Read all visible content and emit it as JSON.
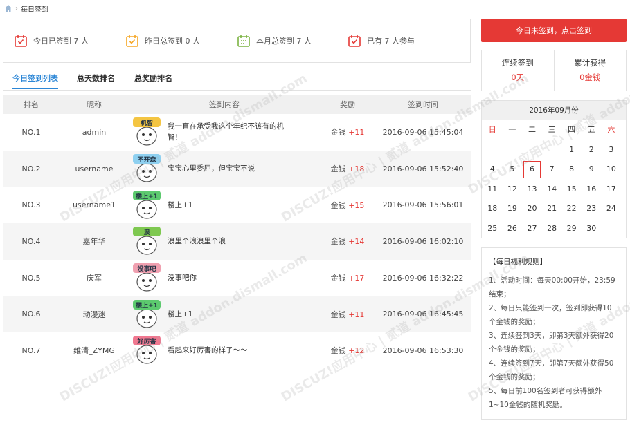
{
  "breadcrumb": {
    "current": "每日签到"
  },
  "stats": [
    {
      "text": "今日已签到 7 人",
      "color": "#e53935"
    },
    {
      "text": "昨日总签到 0 人",
      "color": "#f5a623"
    },
    {
      "text": "本月总签到 7 人",
      "color": "#7cb342"
    },
    {
      "text": "已有 7 人参与",
      "color": "#e53935"
    }
  ],
  "tabs": [
    {
      "label": "今日签到列表",
      "active": true
    },
    {
      "label": "总天数排名",
      "active": false
    },
    {
      "label": "总奖励排名",
      "active": false
    }
  ],
  "table": {
    "headers": [
      "排名",
      "昵称",
      "签到内容",
      "奖励",
      "签到时间"
    ],
    "rows": [
      {
        "rank": "NO.1",
        "name": "admin",
        "sticker_text": "机智",
        "message": "我一直在承受我这个年纪不该有的机智！",
        "reward_label": "金钱",
        "reward_value": "+11",
        "time": "2016-09-06 15:45:04"
      },
      {
        "rank": "NO.2",
        "name": "username",
        "sticker_text": "不开森",
        "message": "宝宝心里委屈，但宝宝不说",
        "reward_label": "金钱",
        "reward_value": "+18",
        "time": "2016-09-06 15:52:40"
      },
      {
        "rank": "NO.3",
        "name": "username1",
        "sticker_text": "楼上+1",
        "message": "楼上+1",
        "reward_label": "金钱",
        "reward_value": "+15",
        "time": "2016-09-06 15:56:01"
      },
      {
        "rank": "NO.4",
        "name": "嘉年华",
        "sticker_text": "浪",
        "message": "浪里个浪浪里个浪",
        "reward_label": "金钱",
        "reward_value": "+14",
        "time": "2016-09-06 16:02:10"
      },
      {
        "rank": "NO.5",
        "name": "庆军",
        "sticker_text": "没事吧",
        "message": "没事吧你",
        "reward_label": "金钱",
        "reward_value": "+17",
        "time": "2016-09-06 16:32:22"
      },
      {
        "rank": "NO.6",
        "name": "动漫迷",
        "sticker_text": "楼上+1",
        "message": "楼上+1",
        "reward_label": "金钱",
        "reward_value": "+11",
        "time": "2016-09-06 16:45:45"
      },
      {
        "rank": "NO.7",
        "name": "维清_ZYMG",
        "sticker_text": "好厉害",
        "message": "看起来好厉害的样子～～",
        "reward_label": "金钱",
        "reward_value": "+12",
        "time": "2016-09-06 16:53:30"
      }
    ]
  },
  "signin_button": "今日未签到，点击签到",
  "streak": {
    "continuous_label": "连续签到",
    "continuous_value": "0天",
    "total_label": "累计获得",
    "total_value": "0金钱"
  },
  "calendar": {
    "title": "2016年09月份",
    "weekdays": [
      "日",
      "一",
      "二",
      "三",
      "四",
      "五",
      "六"
    ],
    "days": [
      "",
      "",
      "",
      "",
      "1",
      "2",
      "3",
      "4",
      "5",
      "6",
      "7",
      "8",
      "9",
      "10",
      "11",
      "12",
      "13",
      "14",
      "15",
      "16",
      "17",
      "18",
      "19",
      "20",
      "21",
      "22",
      "23",
      "24",
      "25",
      "26",
      "27",
      "28",
      "29",
      "30",
      ""
    ],
    "today": "6"
  },
  "rules": {
    "title": "【每日福利规则】",
    "items": [
      "1、活动时间：每天00:00开始，23:59结束；",
      "2、每日只能签到一次，签到即获得10个金钱的奖励；",
      "3、连续签到3天，即第3天额外获得20个金钱的奖励；",
      "4、连续签到7天，即第7天额外获得50个金钱的奖励；",
      "5、每日前100名签到者可获得额外1~10金钱的随机奖励。"
    ]
  },
  "watermark": "DISCUZ!应用中心 | 贰道 addon.dismall.com"
}
